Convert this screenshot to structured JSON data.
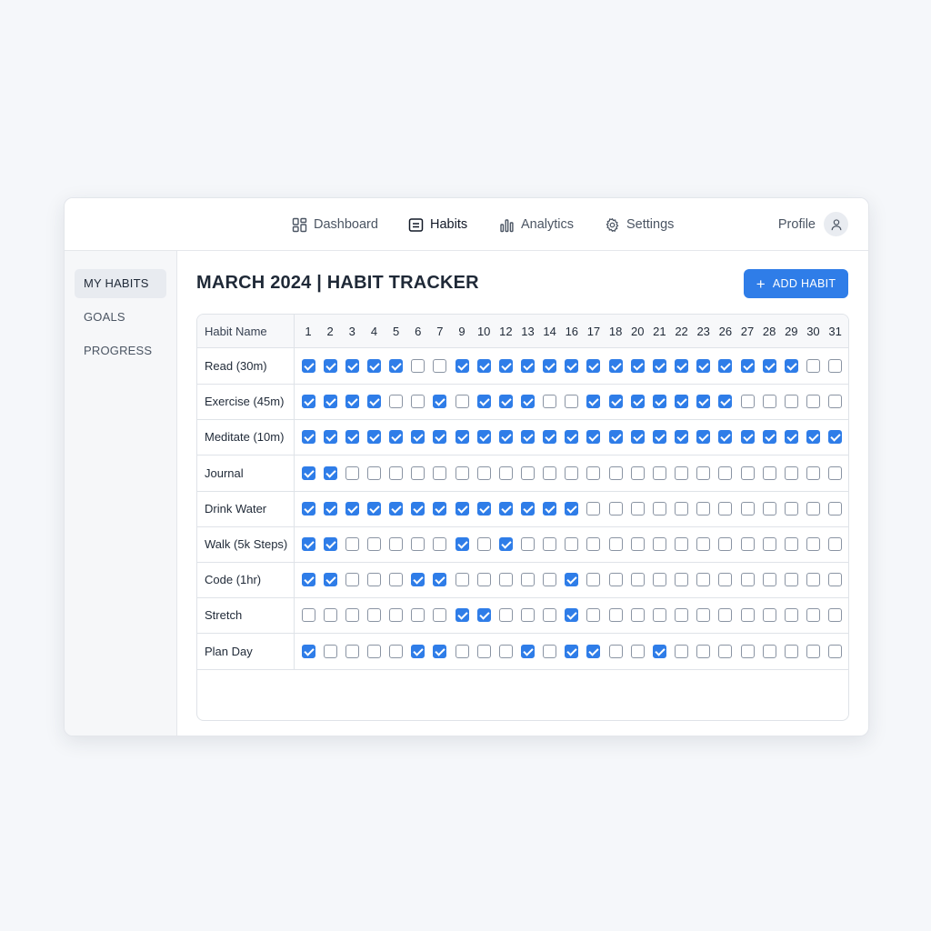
{
  "nav": {
    "items": [
      {
        "label": "Dashboard",
        "icon": "dashboard-icon"
      },
      {
        "label": "Habits",
        "icon": "habits-icon",
        "active": true
      },
      {
        "label": "Analytics",
        "icon": "bar-chart-icon"
      },
      {
        "label": "Settings",
        "icon": "gear-icon"
      }
    ],
    "profile_label": "Profile"
  },
  "sidebar": {
    "items": [
      {
        "label": "MY HABITS",
        "active": true
      },
      {
        "label": "GOALS"
      },
      {
        "label": "PROGRESS"
      }
    ]
  },
  "main": {
    "title": "MARCH 2024 | HABIT TRACKER",
    "add_button_label": "ADD HABIT"
  },
  "table": {
    "name_header": "Habit Name",
    "days": [
      "1",
      "2",
      "3",
      "4",
      "5",
      "6",
      "7",
      "9",
      "10",
      "12",
      "13",
      "14",
      "16",
      "17",
      "18",
      "20",
      "21",
      "22",
      "23",
      "26",
      "27",
      "28",
      "29",
      "30",
      "31"
    ],
    "rows": [
      {
        "name": "Read (30m)",
        "checks": [
          1,
          1,
          1,
          1,
          1,
          0,
          0,
          1,
          1,
          1,
          1,
          1,
          1,
          1,
          1,
          1,
          1,
          1,
          1,
          1,
          1,
          1,
          1,
          0,
          0
        ]
      },
      {
        "name": "Exercise (45m)",
        "checks": [
          1,
          1,
          1,
          1,
          0,
          0,
          1,
          0,
          1,
          1,
          1,
          0,
          0,
          1,
          1,
          1,
          1,
          1,
          1,
          1,
          0,
          0,
          0,
          0,
          0
        ]
      },
      {
        "name": "Meditate (10m)",
        "checks": [
          1,
          1,
          1,
          1,
          1,
          1,
          1,
          1,
          1,
          1,
          1,
          1,
          1,
          1,
          1,
          1,
          1,
          1,
          1,
          1,
          1,
          1,
          1,
          1,
          1
        ]
      },
      {
        "name": "Journal",
        "checks": [
          1,
          1,
          0,
          0,
          0,
          0,
          0,
          0,
          0,
          0,
          0,
          0,
          0,
          0,
          0,
          0,
          0,
          0,
          0,
          0,
          0,
          0,
          0,
          0,
          0
        ]
      },
      {
        "name": "Drink Water",
        "checks": [
          1,
          1,
          1,
          1,
          1,
          1,
          1,
          1,
          1,
          1,
          1,
          1,
          1,
          0,
          0,
          0,
          0,
          0,
          0,
          0,
          0,
          0,
          0,
          0,
          0
        ]
      },
      {
        "name": "Walk (5k Steps)",
        "checks": [
          1,
          1,
          0,
          0,
          0,
          0,
          0,
          1,
          0,
          1,
          0,
          0,
          0,
          0,
          0,
          0,
          0,
          0,
          0,
          0,
          0,
          0,
          0,
          0,
          0
        ]
      },
      {
        "name": "Code (1hr)",
        "checks": [
          1,
          1,
          0,
          0,
          0,
          1,
          1,
          0,
          0,
          0,
          0,
          0,
          1,
          0,
          0,
          0,
          0,
          0,
          0,
          0,
          0,
          0,
          0,
          0,
          0
        ]
      },
      {
        "name": "Stretch",
        "checks": [
          0,
          0,
          0,
          0,
          0,
          0,
          0,
          1,
          1,
          0,
          0,
          0,
          1,
          0,
          0,
          0,
          0,
          0,
          0,
          0,
          0,
          0,
          0,
          0,
          0
        ]
      },
      {
        "name": "Plan Day",
        "checks": [
          1,
          0,
          0,
          0,
          0,
          1,
          1,
          0,
          0,
          0,
          1,
          0,
          1,
          1,
          0,
          0,
          1,
          0,
          0,
          0,
          0,
          0,
          0,
          0,
          0
        ]
      }
    ]
  },
  "colors": {
    "accent": "#2f7de8",
    "background": "#f5f7fa",
    "border": "#dfe3e8"
  }
}
